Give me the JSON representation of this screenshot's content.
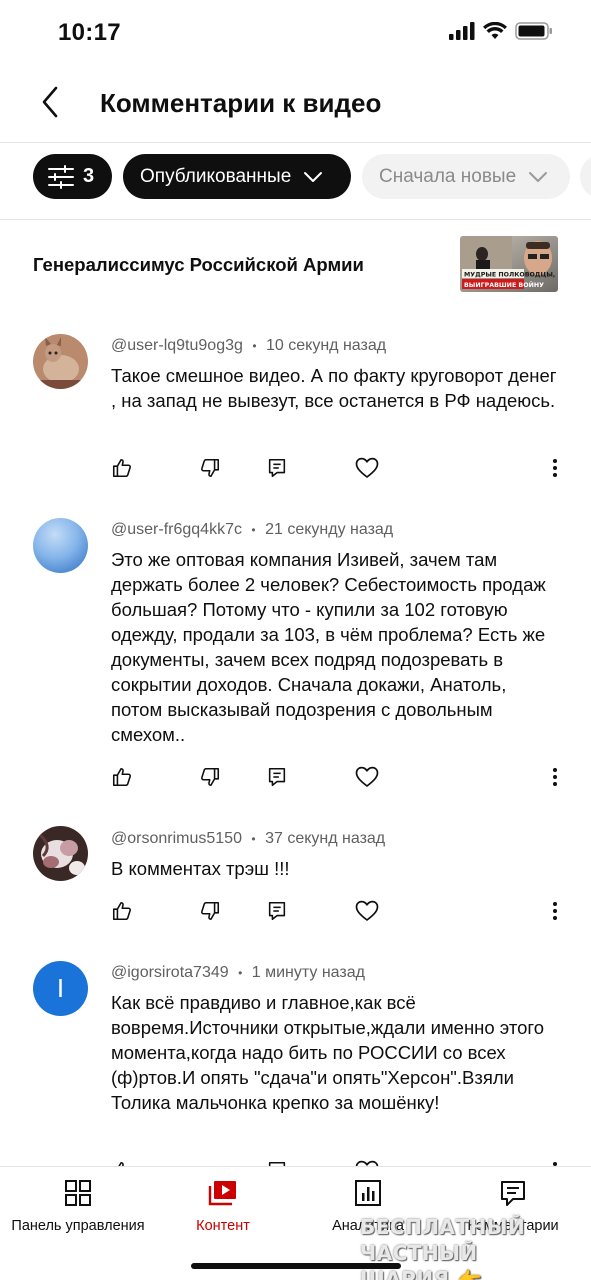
{
  "status_bar": {
    "time": "10:17"
  },
  "header": {
    "title": "Комментарии к видео"
  },
  "filters": {
    "filter_count": "3",
    "published_label": "Опубликованные",
    "sort_label": "Сначала новые"
  },
  "video": {
    "title": "Генералиссимус Российской Армии",
    "thumb_caption_1": "МУДРЫЕ ПОЛКОВОДЦЫ,",
    "thumb_caption_2": "ВЫИГРАВШИЕ ВОЙНУ"
  },
  "comments": [
    {
      "author": "@user-lq9tu9og3g",
      "separator": "•",
      "time": "10 секунд назад",
      "text": "Такое смешное видео. А по факту круговорот денег , на запад не вывезут, все останется в РФ надеюсь."
    },
    {
      "author": "@user-fr6gq4kk7c",
      "separator": "•",
      "time": "21 секунду назад",
      "text": "Это же оптовая компания Изивей, зачем там держать более 2 человек? Себестоимость продаж большая? Потому что - купили за 102 готовую одежду, продали за 103, в чём проблема? Есть же документы, зачем всех подряд подозревать в сокрытии доходов. Сначала докажи, Анатоль, потом высказывай подозрения с довольным смехом.."
    },
    {
      "author": "@orsonrimus5150",
      "separator": "•",
      "time": "37 секунд назад",
      "text": "В комментах трэш !!!"
    },
    {
      "author": "@igorsirota7349",
      "separator": "•",
      "time": "1 минуту назад",
      "avatar_letter": "I",
      "text": "Как всё правдиво и главное,как всё вовремя.Источники открытые,ждали именно этого момента,когда надо бить по РОССИИ со всех (ф)ртов.И опять \"сдача\"и опять\"Херсон\".Взяли Толика мальчонка крепко за мошёнку!"
    }
  ],
  "bottom_nav": {
    "items": [
      {
        "label": "Панель управления",
        "icon": "dashboard-icon"
      },
      {
        "label": "Контент",
        "icon": "content-icon",
        "active": true
      },
      {
        "label": "Аналитика",
        "icon": "analytics-icon"
      },
      {
        "label": "Комментарии",
        "icon": "comments-icon"
      }
    ]
  },
  "watermark": {
    "line1": "БЕСПЛАТНЫЙ ЧАСТНЫЙ",
    "line2": "ШАРИЯ 👉 Sharij.net"
  },
  "colors": {
    "accent": "#cc0000",
    "chip_dark": "#0f0f0f",
    "chip_light": "#f2f2f2",
    "avatar_blue": "#1a73d9"
  }
}
